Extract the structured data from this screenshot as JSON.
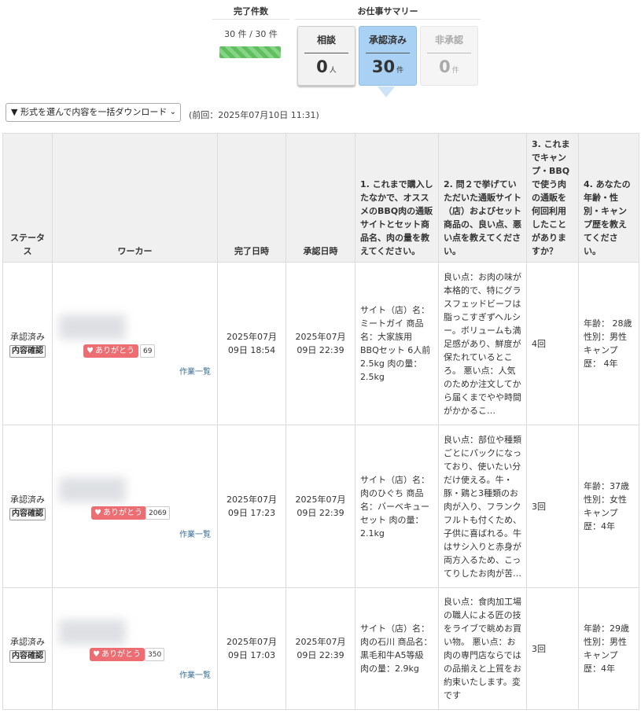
{
  "summary": {
    "done_title": "完了件数",
    "done_count": "30 件 / 30 件",
    "done_progress": 1.0,
    "work_title": "お仕事サマリー",
    "cards": [
      {
        "label": "相談",
        "value": "0",
        "unit": "人"
      },
      {
        "label": "承認済み",
        "value": "30",
        "unit": "件"
      },
      {
        "label": "非承認",
        "value": "0",
        "unit": "件"
      }
    ]
  },
  "download": {
    "select_label": "▼ 形式を選んで内容を一括ダウンロード",
    "previous": "(前回：2025年07月10日 11:31)"
  },
  "table": {
    "headers": {
      "status": "ステータス",
      "worker": "ワーカー",
      "done_at": "完了日時",
      "approved_at": "承認日時",
      "q1": "1. これまで購入したなかで、オススメのBBQ肉の通販サイトとセット商品名、肉の量を教えてください。",
      "q2": "2. 問２で挙げていただいた通販サイト（店）およびセット商品の、良い点、悪い点を教えてください。",
      "q3": "3. これまでキャンプ・BBQで使う肉の通販を何回利用したことがありますか？",
      "q4": "4. あなたの年齢・性別・キャンプ歴を教えてください。"
    },
    "rows": [
      {
        "status": "承認済み",
        "detail": "内容確認",
        "thanks": "ありがとう",
        "thanks_count": "69",
        "worklist": "作業一覧",
        "done_at": "2025年07月09日 18:54",
        "approved_at": "2025年07月09日 22:39",
        "q1": "サイト（店）名：ミートガイ 商品名：大家族用 BBQセット 6人前 2.5kg 肉の量：2.5kg",
        "q2": "良い点：お肉の味が本格的で、特にグラスフェッドビーフは脂っこすぎずヘルシー。ボリュームも満足感があり、鮮度が保たれているところ。 悪い点：人気のためか注文してから届くまでやや時間がかかるこ…",
        "q3": "4回",
        "q4": "年齢： 28歳 性別：男性 キャンプ歴： 4年"
      },
      {
        "status": "承認済み",
        "detail": "内容確認",
        "thanks": "ありがとう",
        "thanks_count": "2069",
        "worklist": "作業一覧",
        "done_at": "2025年07月09日 17:23",
        "approved_at": "2025年07月09日 22:39",
        "q1": "サイト（店）名：肉のひぐち 商品名：バーベキューセット 肉の量：2.1kg",
        "q2": "良い点：部位や種類ごとにパックになっており、使いたい分だけ使える。牛・豚・鶏と3種類のお肉が入り、フランクフルトも付くため、子供に喜ばれる。牛はサシ入りと赤身が両方入るため、こってりしたお肉が苦…",
        "q3": "3回",
        "q4": "年齢：37歳 性別：女性 キャンプ歴：4年"
      },
      {
        "status": "承認済み",
        "detail": "内容確認",
        "thanks": "ありがとう",
        "thanks_count": "350",
        "worklist": "作業一覧",
        "done_at": "2025年07月09日 17:03",
        "approved_at": "2025年07月09日 22:39",
        "q1": "サイト（店）名：肉の石川 商品名：黒毛和牛A5等級 肉の量：2.9kg",
        "q2": "良い点：食肉加工場の職人による匠の技をライブで眺めお買い物。 悪い点：お肉の専門店ならではの品揃えと上質をお約束いたします。変です",
        "q3": "3回",
        "q4": "年齢：29歳 性別：男性 キャンプ歴：4年"
      }
    ]
  },
  "colors": {
    "thanks": "#ec6e72",
    "approved_card": "#a9d1f3",
    "progress": "#5fbf5f",
    "link": "#3a6f95"
  }
}
